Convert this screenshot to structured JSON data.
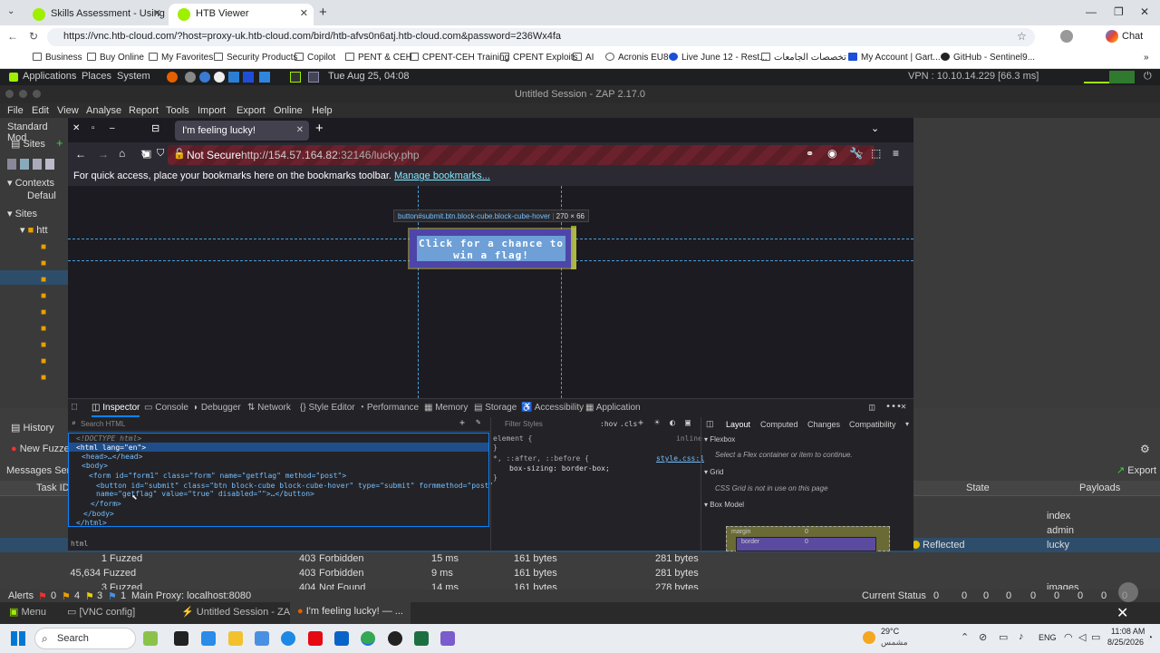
{
  "chrome": {
    "tabs": [
      {
        "title": "Skills Assessment - Using Web Pro",
        "active": false
      },
      {
        "title": "HTB Viewer",
        "active": true
      }
    ],
    "new_tab": "+",
    "url": "https://vnc.htb-cloud.com/?host=proxy-uk.htb-cloud.com/bird/htb-afvs0n6atj.htb-cloud.com&password=236Wx4fa",
    "profile_label": "Chat",
    "bookmarks": [
      "Business",
      "Buy Online",
      "My Favorites",
      "Security Products",
      "Copilot",
      "PENT & CEH",
      "CPENT-CEH Training",
      "CPENT Exploits",
      "AI",
      "Acronis EU8",
      "Live June 12 - Rest...",
      "تخصصات الجامعات",
      "My Account | Gart...",
      "GitHub - Sentinel9..."
    ]
  },
  "gnome": {
    "menus": [
      "Applications",
      "Places",
      "System"
    ],
    "datetime": "Tue Aug 25, 04:08",
    "vpn": "VPN : 10.10.14.229 [66.3 ms]"
  },
  "zap": {
    "title": "Untitled Session - ZAP 2.17.0",
    "menu": [
      "File",
      "Edit",
      "View",
      "Analyse",
      "Report",
      "Tools",
      "Import",
      "Export",
      "Online",
      "Help"
    ],
    "mode": "Standard Mod",
    "sites_tab": "Sites",
    "tree": [
      "Contexts",
      "Defaul",
      "Sites",
      "htt"
    ],
    "history_tab": "History",
    "fuzzer_tab": "New Fuzze",
    "messages_label": "Messages Sent",
    "export_label": "Export",
    "columns": {
      "task": "Task ID",
      "state": "State",
      "payloads": "Payloads"
    },
    "right_rows": [
      {
        "state": "",
        "payload": "index"
      },
      {
        "state": "",
        "payload": "admin"
      },
      {
        "state": "Reflected",
        "payload": "lucky"
      }
    ],
    "rows": [
      {
        "id": "1",
        "status": "Fuzzed",
        "code": "403",
        "reason": "Forbidden",
        "rtt": "15 ms",
        "size": "161 bytes",
        "size2": "281 bytes",
        "payload": ""
      },
      {
        "id": "45,634",
        "status": "Fuzzed",
        "code": "403",
        "reason": "Forbidden",
        "rtt": "9 ms",
        "size": "161 bytes",
        "size2": "281 bytes",
        "payload": ""
      },
      {
        "id": "3",
        "status": "Fuzzed",
        "code": "404",
        "reason": "Not Found",
        "rtt": "14 ms",
        "size": "161 bytes",
        "size2": "278 bytes",
        "payload": "images"
      }
    ],
    "statusbar": {
      "alerts": "Alerts",
      "a1": "0",
      "a2": "4",
      "a3": "3",
      "a4": "1",
      "proxy": "Main Proxy: localhost:8080",
      "current_status": "Current Status",
      "counts": [
        "0",
        "0",
        "0",
        "0",
        "0",
        "0",
        "0",
        "0",
        "0"
      ]
    }
  },
  "firefox": {
    "tab_title": "I'm feeling lucky!",
    "not_secure": "Not Secure",
    "url_host": "http://154.57.164.82",
    "url_rest": ":32146/lucky.php",
    "bookmarks_hint": "For quick access, place your bookmarks here on the bookmarks toolbar.",
    "manage_bookmarks": "Manage bookmarks...",
    "page_button": "Click for a chance to win a flag!",
    "tooltip_selector": "button#submit.btn.block-cube.block-cube-hover",
    "tooltip_size": "270 × 66"
  },
  "devtools": {
    "tabs": [
      "Inspector",
      "Console",
      "Debugger",
      "Network",
      "Style Editor",
      "Performance",
      "Memory",
      "Storage",
      "Accessibility",
      "Application"
    ],
    "search_placeholder": "Search HTML",
    "filter_styles": "Filter Styles",
    "hov": ":hov",
    "cls": ".cls",
    "layout_tabs": [
      "Layout",
      "Computed",
      "Changes",
      "Compatibility"
    ],
    "html_lines": {
      "doctype": "<!DOCTYPE html>",
      "html_open": "<html lang=\"en\">",
      "head": "<head>…</head>",
      "body": "<body>",
      "form": "<form id=\"form1\" class=\"form\" name=\"getflag\" method=\"post\">",
      "button1": "<button id=\"submit\" class=\"btn block-cube block-cube-hover\" type=\"submit\" formmethod=\"post\"",
      "button2": "name=\"getflag\" value=\"true\" disabled=\"\">…</button>",
      "form_close": "</form>",
      "body_close": "</body>",
      "html_close": "</html>"
    },
    "breadcrumb": "html",
    "rules": {
      "element": "element {",
      "element_src": "inline",
      "close": "}",
      "universal": "*, ::after, ::before {",
      "universal_src": "style.css:1",
      "decl": "box-sizing: border-box;"
    },
    "flexbox_title": "Flexbox",
    "flexbox_msg": "Select a Flex container or item to continue.",
    "grid_title": "Grid",
    "grid_msg": "CSS Grid is not in use on this page",
    "boxmodel_title": "Box Model",
    "margin": "margin",
    "border": "border",
    "zero": "0"
  },
  "vnc": {
    "menu": "Menu",
    "items": [
      "[VNC config]",
      "Untitled Session - ZA...",
      "I'm feeling lucky! — ..."
    ]
  },
  "taskbar": {
    "search": "Search",
    "weather_temp": "29°C",
    "weather_desc": "مشمس",
    "lang": "ENG",
    "time": "11:08 AM",
    "date": "8/25/2026"
  }
}
